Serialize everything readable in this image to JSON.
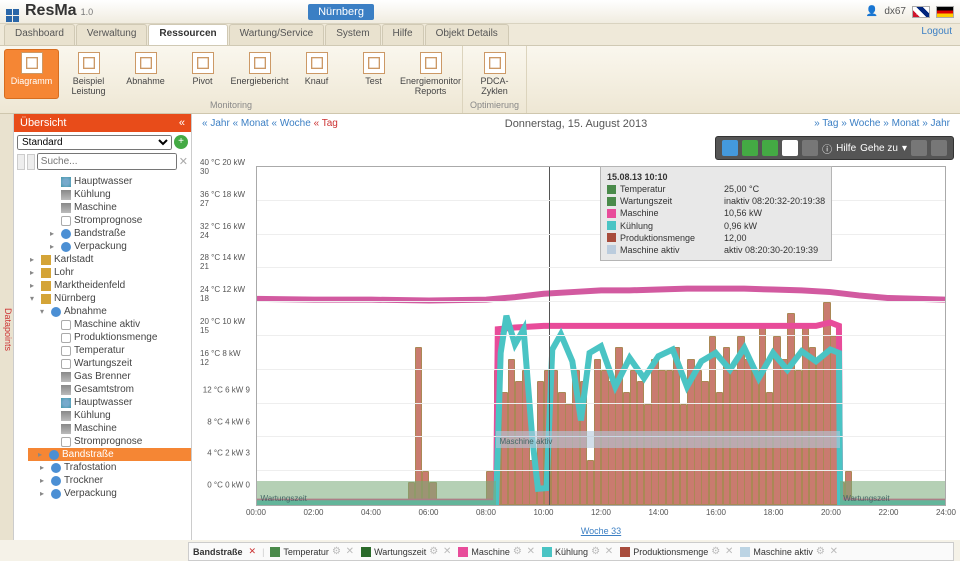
{
  "header": {
    "app_name": "ResMa",
    "version": "1.0",
    "badge": "Nürnberg",
    "user": "dx67",
    "logout": "Logout"
  },
  "menu": {
    "tabs": [
      "Dashboard",
      "Verwaltung",
      "Ressourcen",
      "Wartung/Service",
      "System",
      "Hilfe",
      "Objekt Details"
    ],
    "active": 2
  },
  "ribbon": {
    "groups": [
      {
        "label": "Monitoring",
        "items": [
          {
            "k": "diagramm",
            "label": "Diagramm",
            "on": true
          },
          {
            "k": "beispiel",
            "label": "Beispiel Leistung"
          },
          {
            "k": "abnahme",
            "label": "Abnahme"
          },
          {
            "k": "pivot",
            "label": "Pivot"
          },
          {
            "k": "energiebericht",
            "label": "Energiebericht"
          },
          {
            "k": "knauf",
            "label": "Knauf"
          },
          {
            "k": "test",
            "label": "Test"
          },
          {
            "k": "energiemonitor",
            "label": "Energiemonitor Reports"
          }
        ]
      },
      {
        "label": "Optimierung",
        "items": [
          {
            "k": "pdca",
            "label": "PDCA-Zyklen"
          }
        ]
      }
    ]
  },
  "sidebar": {
    "tab": "Datapoints",
    "title": "Übersicht",
    "dropdown": "Standard",
    "search_ph": "Suche...",
    "tree": [
      {
        "t": "leaf",
        "ic": "cyl",
        "label": "Hauptwasser"
      },
      {
        "t": "leaf",
        "ic": "wr",
        "label": "Kühlung"
      },
      {
        "t": "leaf",
        "ic": "wr",
        "label": "Maschine"
      },
      {
        "t": "leaf",
        "ic": "th",
        "label": "Stromprognose"
      },
      {
        "t": "exp",
        "ic": "bl",
        "label": "Bandstraße"
      },
      {
        "t": "exp",
        "ic": "bl",
        "label": "Verpackung"
      },
      {
        "t": "exp",
        "ic": "home",
        "label": "Karlstadt",
        "lvl": -1
      },
      {
        "t": "exp",
        "ic": "home",
        "label": "Lohr",
        "lvl": -1
      },
      {
        "t": "exp",
        "ic": "home",
        "label": "Marktheidenfeld",
        "lvl": -1
      },
      {
        "t": "open",
        "ic": "home",
        "label": "Nürnberg",
        "lvl": -1
      },
      {
        "t": "open",
        "ic": "bl",
        "label": "Abnahme",
        "lvl": 0
      },
      {
        "t": "leaf",
        "ic": "th",
        "label": "Maschine aktiv",
        "lvl": 1
      },
      {
        "t": "leaf",
        "ic": "th",
        "label": "Produktionsmenge",
        "lvl": 1
      },
      {
        "t": "leaf",
        "ic": "th",
        "label": "Temperatur",
        "lvl": 1
      },
      {
        "t": "leaf",
        "ic": "th",
        "label": "Wartungszeit",
        "lvl": 1
      },
      {
        "t": "leaf",
        "ic": "wr",
        "label": "Gas Brenner",
        "lvl": 1
      },
      {
        "t": "leaf",
        "ic": "wr",
        "label": "Gesamtstrom",
        "lvl": 1
      },
      {
        "t": "leaf",
        "ic": "cyl",
        "label": "Hauptwasser",
        "lvl": 1
      },
      {
        "t": "leaf",
        "ic": "wr",
        "label": "Kühlung",
        "lvl": 1
      },
      {
        "t": "leaf",
        "ic": "wr",
        "label": "Maschine",
        "lvl": 1
      },
      {
        "t": "leaf",
        "ic": "th",
        "label": "Stromprognose",
        "lvl": 1
      },
      {
        "t": "exp",
        "ic": "bl",
        "label": "Bandstraße",
        "lvl": 0,
        "sel": true
      },
      {
        "t": "exp",
        "ic": "bl",
        "label": "Trafostation",
        "lvl": 0
      },
      {
        "t": "exp",
        "ic": "bl",
        "label": "Trockner",
        "lvl": 0
      },
      {
        "t": "exp",
        "ic": "bl",
        "label": "Verpackung",
        "lvl": 0
      }
    ]
  },
  "nav": {
    "left": [
      "« Jahr",
      "« Monat",
      "« Woche",
      "« Tag"
    ],
    "title": "Donnerstag, 15. August 2013",
    "right": [
      "» Tag",
      "» Woche",
      "» Monat",
      "» Jahr"
    ]
  },
  "ctoolbar": {
    "help": "Hilfe",
    "goto": "Gehe zu"
  },
  "tooltip": {
    "ts": "15.08.13 10:10",
    "rows": [
      {
        "c": "#4a8a4a",
        "k": "Temperatur",
        "v": "25,00 °C"
      },
      {
        "c": "#4a8a4a",
        "k": "Wartungszeit",
        "v": "inaktiv 08:20:32-20:19:38"
      },
      {
        "c": "#e84c9a",
        "k": "Maschine",
        "v": "10,56 kW"
      },
      {
        "c": "#4ac4c4",
        "k": "Kühlung",
        "v": "0,96 kW"
      },
      {
        "c": "#a84c3c",
        "k": "Produktionsmenge",
        "v": "12,00"
      },
      {
        "c": "#bcd",
        "k": "Maschine aktiv",
        "v": "aktiv 08:20:30-20:19:39"
      }
    ]
  },
  "legend": {
    "title": "Bandstraße",
    "items": [
      {
        "c": "#4a8a4a",
        "label": "Temperatur"
      },
      {
        "c": "#2a6a2a",
        "label": "Wartungszeit"
      },
      {
        "c": "#e84c9a",
        "label": "Maschine"
      },
      {
        "c": "#4ac4c4",
        "label": "Kühlung"
      },
      {
        "c": "#a84c3c",
        "label": "Produktionsmenge"
      },
      {
        "c": "#bcd4e4",
        "label": "Maschine aktiv"
      }
    ]
  },
  "chart_data": {
    "type": "mixed",
    "x_unit": "hour",
    "x_range": [
      0,
      24
    ],
    "title": "Donnerstag, 15. August 2013",
    "week_link": "Woche 33",
    "y_axes": [
      {
        "label": "°C",
        "range": [
          0,
          40
        ],
        "step": 4
      },
      {
        "label": "kW",
        "range": [
          0,
          20
        ],
        "step": 2
      },
      {
        "label": "",
        "range": [
          0,
          30
        ],
        "step": 3
      }
    ],
    "x_ticks": [
      0,
      2,
      4,
      6,
      8,
      10,
      12,
      14,
      16,
      18,
      20,
      22,
      24
    ],
    "bands": [
      {
        "name": "Wartungszeit",
        "y0": 0,
        "y1": 1.4,
        "x0": 0,
        "x1": 8.34,
        "label": "Wartungszeit"
      },
      {
        "name": "Wartungszeit",
        "y0": 0,
        "y1": 1.4,
        "x0": 20.33,
        "x1": 24,
        "label": "Wartungszeit"
      },
      {
        "name": "Maschine aktiv",
        "y0": 3.4,
        "y1": 4.4,
        "x0": 8.34,
        "x1": 20.33,
        "label": "Maschine aktiv"
      }
    ],
    "series": [
      {
        "name": "Temperatur",
        "type": "line",
        "color": "#d25aa0",
        "axis": 0,
        "points": [
          [
            0,
            24.4
          ],
          [
            2,
            24.3
          ],
          [
            4,
            24.3
          ],
          [
            6,
            24.2
          ],
          [
            8,
            24.3
          ],
          [
            9,
            24.6
          ],
          [
            10,
            25.0
          ],
          [
            11,
            25.2
          ],
          [
            12,
            25.4
          ],
          [
            13,
            25.4
          ],
          [
            14,
            25.5
          ],
          [
            15,
            25.6
          ],
          [
            16,
            25.6
          ],
          [
            17,
            25.6
          ],
          [
            18,
            25.5
          ],
          [
            19,
            25.4
          ],
          [
            20,
            25.2
          ],
          [
            21,
            24.8
          ],
          [
            22,
            24.5
          ],
          [
            24,
            24.3
          ]
        ]
      },
      {
        "name": "Maschine",
        "type": "line",
        "color": "#e84c9a",
        "axis": 1,
        "points": [
          [
            0,
            0.2
          ],
          [
            7.5,
            0.2
          ],
          [
            8.34,
            0.2
          ],
          [
            8.4,
            10.4
          ],
          [
            9,
            10.5
          ],
          [
            10,
            10.6
          ],
          [
            11,
            10.6
          ],
          [
            12,
            10.6
          ],
          [
            14,
            10.6
          ],
          [
            16,
            10.6
          ],
          [
            18,
            10.6
          ],
          [
            19.5,
            10.6
          ],
          [
            20,
            10.8
          ],
          [
            20.3,
            10.6
          ],
          [
            20.34,
            0.3
          ],
          [
            21,
            0.2
          ],
          [
            24,
            0.2
          ]
        ]
      },
      {
        "name": "Kühlung",
        "type": "line",
        "color": "#4ac4c4",
        "axis": 1,
        "points": [
          [
            0,
            0.1
          ],
          [
            8.2,
            0.1
          ],
          [
            8.34,
            0.1
          ],
          [
            8.5,
            9.0
          ],
          [
            8.7,
            11.2
          ],
          [
            9.0,
            9.5
          ],
          [
            9.3,
            10.4
          ],
          [
            9.6,
            4.0
          ],
          [
            9.8,
            0.96
          ],
          [
            10.1,
            1.0
          ],
          [
            10.3,
            9.2
          ],
          [
            10.6,
            10.1
          ],
          [
            11,
            8.5
          ],
          [
            11.3,
            5.0
          ],
          [
            11.6,
            9.0
          ],
          [
            12,
            9.4
          ],
          [
            12.5,
            7.0
          ],
          [
            13,
            8.7
          ],
          [
            13.5,
            7.5
          ],
          [
            14,
            8.8
          ],
          [
            14.5,
            9.2
          ],
          [
            15,
            7.0
          ],
          [
            15.5,
            8.5
          ],
          [
            16,
            9.0
          ],
          [
            16.5,
            8.0
          ],
          [
            17,
            9.3
          ],
          [
            17.5,
            7.5
          ],
          [
            18,
            9.0
          ],
          [
            18.5,
            8.0
          ],
          [
            19,
            9.1
          ],
          [
            19.5,
            8.5
          ],
          [
            20,
            9.2
          ],
          [
            20.3,
            9.0
          ],
          [
            20.34,
            0.1
          ],
          [
            24,
            0.1
          ]
        ]
      },
      {
        "name": "Produktionsmenge",
        "type": "bar",
        "color": "#c97b6f",
        "axis": 2,
        "bars": [
          [
            5.25,
            2
          ],
          [
            5.5,
            14
          ],
          [
            5.75,
            3
          ],
          [
            6.0,
            2
          ],
          [
            8.0,
            3
          ],
          [
            8.25,
            12
          ],
          [
            8.5,
            10
          ],
          [
            8.75,
            13
          ],
          [
            9.0,
            11
          ],
          [
            9.25,
            12
          ],
          [
            9.5,
            4
          ],
          [
            9.75,
            11
          ],
          [
            10.0,
            12
          ],
          [
            10.25,
            12
          ],
          [
            10.5,
            10
          ],
          [
            10.75,
            9
          ],
          [
            11.0,
            12
          ],
          [
            11.25,
            11
          ],
          [
            11.5,
            4
          ],
          [
            11.75,
            13
          ],
          [
            12.0,
            12
          ],
          [
            12.25,
            11
          ],
          [
            12.5,
            14
          ],
          [
            12.75,
            10
          ],
          [
            13.0,
            12
          ],
          [
            13.25,
            11
          ],
          [
            13.5,
            9
          ],
          [
            13.75,
            13
          ],
          [
            14.0,
            12
          ],
          [
            14.25,
            12
          ],
          [
            14.5,
            14
          ],
          [
            14.75,
            9
          ],
          [
            15.0,
            13
          ],
          [
            15.25,
            12
          ],
          [
            15.5,
            11
          ],
          [
            15.75,
            15
          ],
          [
            16.0,
            10
          ],
          [
            16.25,
            14
          ],
          [
            16.5,
            12
          ],
          [
            16.75,
            15
          ],
          [
            17.0,
            13
          ],
          [
            17.25,
            12
          ],
          [
            17.5,
            16
          ],
          [
            17.75,
            10
          ],
          [
            18.0,
            15
          ],
          [
            18.25,
            13
          ],
          [
            18.5,
            17
          ],
          [
            18.75,
            12
          ],
          [
            19.0,
            16
          ],
          [
            19.25,
            14
          ],
          [
            19.5,
            13
          ],
          [
            19.75,
            18
          ],
          [
            20.0,
            15
          ],
          [
            20.25,
            2
          ],
          [
            20.5,
            3
          ]
        ]
      }
    ],
    "cursor_x": 10.17
  }
}
